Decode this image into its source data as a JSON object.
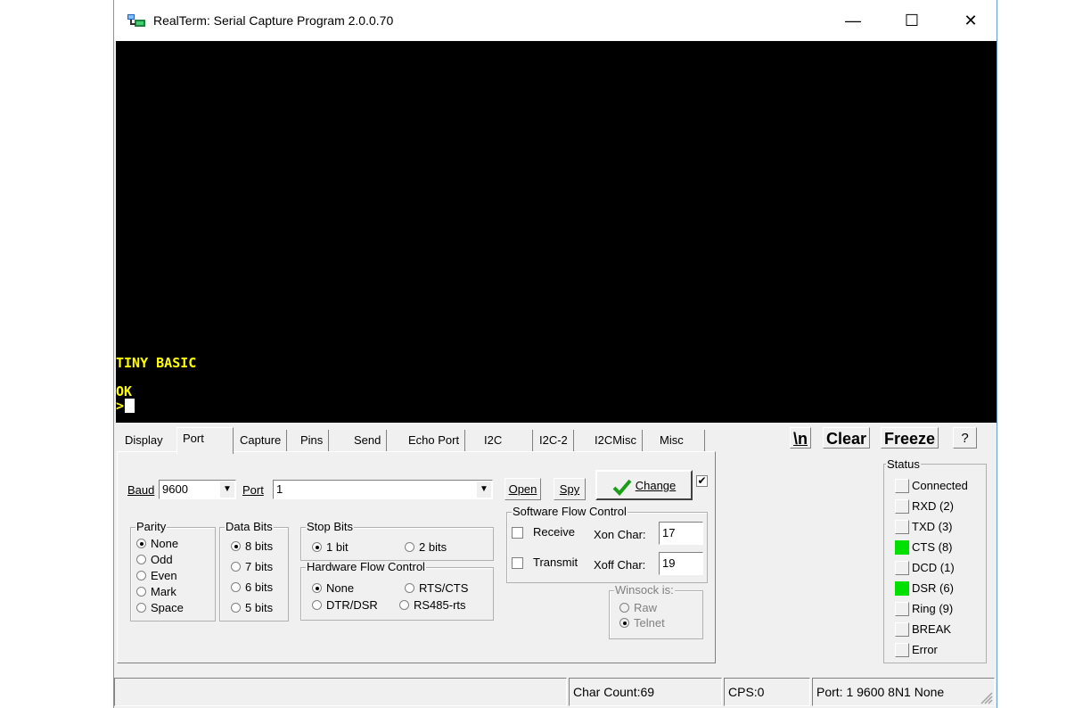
{
  "window": {
    "title": "RealTerm: Serial Capture Program 2.0.0.70",
    "minimize": "—",
    "maximize": "☐",
    "close": "✕"
  },
  "terminal": {
    "lines": [
      "TINY BASIC",
      "OK",
      ">"
    ],
    "text_color": "#ffff00"
  },
  "tabs": [
    "Display",
    "Port",
    "Capture",
    "Pins",
    "Send",
    "Echo Port",
    "I2C",
    "I2C-2",
    "I2CMisc",
    "Misc"
  ],
  "active_tab": "Port",
  "toolbar": {
    "newline": "\\n",
    "clear": "Clear",
    "freeze": "Freeze",
    "help": "?"
  },
  "port": {
    "baud_label": "Baud",
    "baud_value": "9600",
    "port_label": "Port",
    "port_value": "1",
    "open": "Open",
    "spy": "Spy",
    "change": "Change",
    "change_checked": true
  },
  "parity": {
    "title": "Parity",
    "options": [
      "None",
      "Odd",
      "Even",
      "Mark",
      "Space"
    ],
    "selected": "None"
  },
  "data_bits": {
    "title": "Data Bits",
    "options": [
      "8 bits",
      "7 bits",
      "6 bits",
      "5 bits"
    ],
    "selected": "8 bits"
  },
  "stop_bits": {
    "title": "Stop Bits",
    "options": [
      "1 bit",
      "2 bits"
    ],
    "selected": "1 bit"
  },
  "hw_flow": {
    "title": "Hardware Flow Control",
    "options": [
      "None",
      "RTS/CTS",
      "DTR/DSR",
      "RS485-rts"
    ],
    "selected": "None"
  },
  "sw_flow": {
    "title": "Software Flow Control",
    "receive": "Receive",
    "transmit": "Transmit",
    "xon_label": "Xon Char:",
    "xon_value": "17",
    "xoff_label": "Xoff Char:",
    "xoff_value": "19"
  },
  "winsock": {
    "title": "Winsock is:",
    "options": [
      "Raw",
      "Telnet"
    ],
    "selected": "Telnet"
  },
  "status": {
    "title": "Status",
    "items": [
      {
        "label": "Connected",
        "on": false
      },
      {
        "label": "RXD (2)",
        "on": false
      },
      {
        "label": "TXD (3)",
        "on": false
      },
      {
        "label": "CTS (8)",
        "on": true
      },
      {
        "label": "DCD (1)",
        "on": false
      },
      {
        "label": "DSR (6)",
        "on": true
      },
      {
        "label": "Ring (9)",
        "on": false
      },
      {
        "label": "BREAK",
        "on": false
      },
      {
        "label": "Error",
        "on": false
      }
    ],
    "on_color": "#00e000"
  },
  "statusbar": {
    "char_count": "Char Count:69",
    "cps": "CPS:0",
    "port_info": "Port: 1 9600 8N1 None"
  }
}
